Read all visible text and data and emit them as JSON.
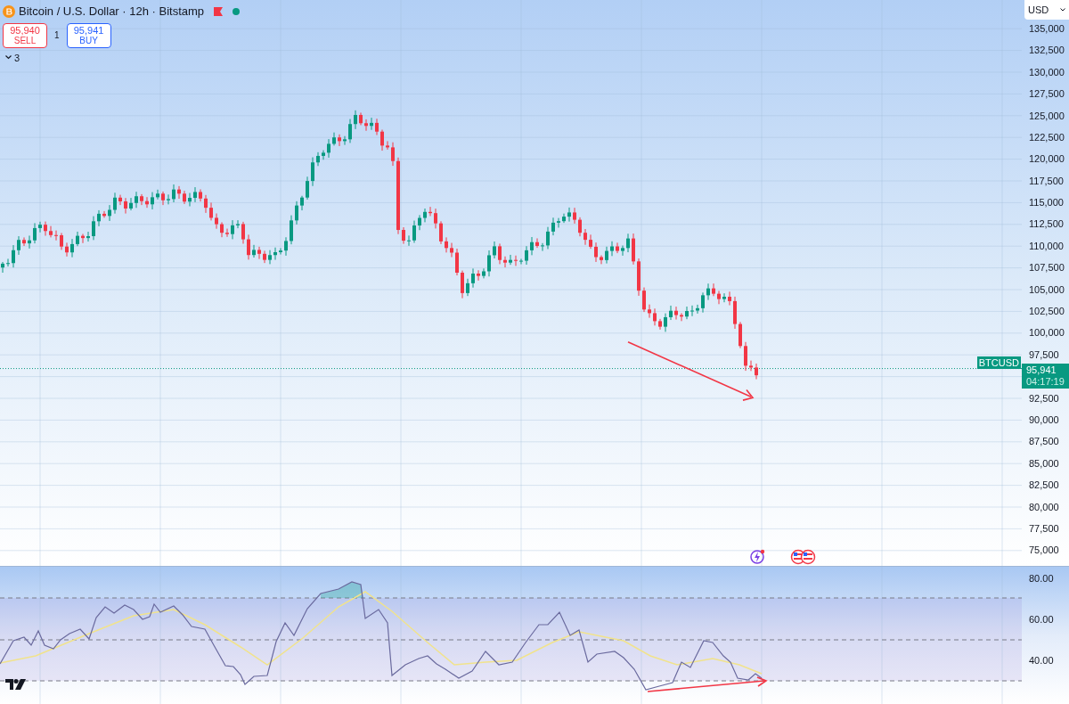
{
  "header": {
    "title": "Bitcoin / U.S. Dollar · 12h · Bitstamp",
    "market_open": true,
    "sell": {
      "price": "95,940",
      "label": "SELL"
    },
    "spread": "1",
    "buy": {
      "price": "95,941",
      "label": "BUY"
    },
    "indicators_count": "3"
  },
  "currency": "USD",
  "price_axis": {
    "ticks_upper": [
      "135,000",
      "132,500",
      "130,000",
      "127,500",
      "125,000",
      "122,500",
      "120,000",
      "117,500",
      "115,000",
      "112,500",
      "110,000",
      "107,500",
      "105,000",
      "102,500",
      "100,000",
      "97,500"
    ],
    "ticks_lower": [
      "92,500",
      "90,000",
      "87,500",
      "85,000",
      "82,500",
      "80,000",
      "77,500",
      "75,000"
    ]
  },
  "last_price": {
    "symbol": "BTCUSD",
    "price": "95,941",
    "countdown": "04:17:19"
  },
  "rsi_axis": {
    "ticks": [
      "80.00",
      "60.00",
      "40.00"
    ]
  }
}
